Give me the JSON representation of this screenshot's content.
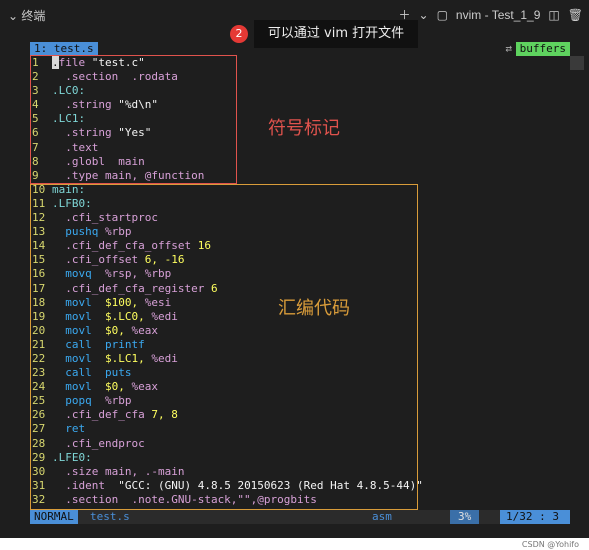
{
  "terminal": {
    "title": "终端",
    "instance": "nvim - Test_1_9"
  },
  "tab": {
    "active": "1: test.s",
    "buffers": "buffers"
  },
  "tooltip": {
    "badge": "2",
    "text": "可以通过 vim 打开文件"
  },
  "annotations": {
    "symbols": "符号标记",
    "code": "汇编代码"
  },
  "lines": [
    {
      "n": "1",
      "parts": [
        {
          "t": ".",
          "c": "cursor"
        },
        {
          "t": "file ",
          "c": "dir"
        },
        {
          "t": "\"test.c\"",
          "c": "str"
        }
      ]
    },
    {
      "n": "2",
      "parts": [
        {
          "t": "  .section  .rodata",
          "c": "dir"
        }
      ]
    },
    {
      "n": "3",
      "parts": [
        {
          "t": ".LC0:",
          "c": "lbl"
        }
      ]
    },
    {
      "n": "4",
      "parts": [
        {
          "t": "  .string ",
          "c": "dir"
        },
        {
          "t": "\"%d\\n\"",
          "c": "str"
        }
      ]
    },
    {
      "n": "5",
      "parts": [
        {
          "t": ".LC1:",
          "c": "lbl"
        }
      ]
    },
    {
      "n": "6",
      "parts": [
        {
          "t": "  .string ",
          "c": "dir"
        },
        {
          "t": "\"Yes\"",
          "c": "str"
        }
      ]
    },
    {
      "n": "7",
      "parts": [
        {
          "t": "  .text",
          "c": "dir"
        }
      ]
    },
    {
      "n": "8",
      "parts": [
        {
          "t": "  .globl  main",
          "c": "dir"
        }
      ]
    },
    {
      "n": "9",
      "parts": [
        {
          "t": "  .type main, @function",
          "c": "dir"
        }
      ]
    },
    {
      "n": "10",
      "parts": [
        {
          "t": "main:",
          "c": "lbl"
        }
      ]
    },
    {
      "n": "11",
      "parts": [
        {
          "t": ".LFB0:",
          "c": "lbl"
        }
      ]
    },
    {
      "n": "12",
      "parts": [
        {
          "t": "  .cfi_startproc",
          "c": "dir"
        }
      ]
    },
    {
      "n": "13",
      "parts": [
        {
          "t": "  pushq ",
          "c": "ins"
        },
        {
          "t": "%rbp",
          "c": "reg"
        }
      ]
    },
    {
      "n": "14",
      "parts": [
        {
          "t": "  .cfi_def_cfa_offset ",
          "c": "dir"
        },
        {
          "t": "16",
          "c": "num"
        }
      ]
    },
    {
      "n": "15",
      "parts": [
        {
          "t": "  .cfi_offset ",
          "c": "dir"
        },
        {
          "t": "6, -16",
          "c": "num"
        }
      ]
    },
    {
      "n": "16",
      "parts": [
        {
          "t": "  movq  ",
          "c": "ins"
        },
        {
          "t": "%rsp, %rbp",
          "c": "reg"
        }
      ]
    },
    {
      "n": "17",
      "parts": [
        {
          "t": "  .cfi_def_cfa_register ",
          "c": "dir"
        },
        {
          "t": "6",
          "c": "num"
        }
      ]
    },
    {
      "n": "18",
      "parts": [
        {
          "t": "  movl  ",
          "c": "ins"
        },
        {
          "t": "$100, ",
          "c": "num"
        },
        {
          "t": "%esi",
          "c": "reg"
        }
      ]
    },
    {
      "n": "19",
      "parts": [
        {
          "t": "  movl  ",
          "c": "ins"
        },
        {
          "t": "$.LC0, ",
          "c": "num"
        },
        {
          "t": "%edi",
          "c": "reg"
        }
      ]
    },
    {
      "n": "20",
      "parts": [
        {
          "t": "  movl  ",
          "c": "ins"
        },
        {
          "t": "$0, ",
          "c": "num"
        },
        {
          "t": "%eax",
          "c": "reg"
        }
      ]
    },
    {
      "n": "21",
      "parts": [
        {
          "t": "  call  printf",
          "c": "ins"
        }
      ]
    },
    {
      "n": "22",
      "parts": [
        {
          "t": "  movl  ",
          "c": "ins"
        },
        {
          "t": "$.LC1, ",
          "c": "num"
        },
        {
          "t": "%edi",
          "c": "reg"
        }
      ]
    },
    {
      "n": "23",
      "parts": [
        {
          "t": "  call  puts",
          "c": "ins"
        }
      ]
    },
    {
      "n": "24",
      "parts": [
        {
          "t": "  movl  ",
          "c": "ins"
        },
        {
          "t": "$0, ",
          "c": "num"
        },
        {
          "t": "%eax",
          "c": "reg"
        }
      ]
    },
    {
      "n": "25",
      "parts": [
        {
          "t": "  popq  ",
          "c": "ins"
        },
        {
          "t": "%rbp",
          "c": "reg"
        }
      ]
    },
    {
      "n": "26",
      "parts": [
        {
          "t": "  .cfi_def_cfa ",
          "c": "dir"
        },
        {
          "t": "7, 8",
          "c": "num"
        }
      ]
    },
    {
      "n": "27",
      "parts": [
        {
          "t": "  ret",
          "c": "ins"
        }
      ]
    },
    {
      "n": "28",
      "parts": [
        {
          "t": "  .cfi_endproc",
          "c": "dir"
        }
      ]
    },
    {
      "n": "29",
      "parts": [
        {
          "t": ".LFE0:",
          "c": "lbl"
        }
      ]
    },
    {
      "n": "30",
      "parts": [
        {
          "t": "  .size main, .-main",
          "c": "dir"
        }
      ]
    },
    {
      "n": "31",
      "parts": [
        {
          "t": "  .ident  ",
          "c": "dir"
        },
        {
          "t": "\"GCC: (GNU) 4.8.5 20150623 (Red Hat 4.8.5-44)\"",
          "c": "str"
        }
      ]
    },
    {
      "n": "32",
      "parts": [
        {
          "t": "  .section  .note.GNU-stack,\"\",@progbits",
          "c": "dir"
        }
      ]
    }
  ],
  "status": {
    "mode": "NORMAL",
    "file": "test.s",
    "filetype": "asm",
    "percent": "3%",
    "position": "1/32 :  3"
  },
  "credit": "CSDN @Yohifo"
}
